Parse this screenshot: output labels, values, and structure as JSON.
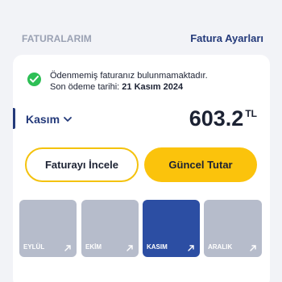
{
  "header": {
    "title": "FATURALARIM",
    "settings_link": "Fatura Ayarları"
  },
  "notice": {
    "message": "Ödenmemiş faturanız bulunmamaktadır.",
    "due_prefix": "Son ödeme tarihi:",
    "due_date": "21 Kasım 2024",
    "icon": "check-circle-icon",
    "color": "#2dbf55"
  },
  "bill": {
    "selected_month": "Kasım",
    "amount": "603.2",
    "currency": "TL"
  },
  "actions": {
    "review_label": "Faturayı İncele",
    "current_label": "Güncel Tutar"
  },
  "months": [
    {
      "label": "EYLÜL",
      "active": false
    },
    {
      "label": "EKİM",
      "active": false
    },
    {
      "label": "KASIM",
      "active": true
    },
    {
      "label": "ARALIK",
      "active": false
    }
  ],
  "colors": {
    "accent": "#fbc30c",
    "brand": "#243a7a",
    "active_month": "#2c4ea3",
    "inactive_month": "#b6bccb"
  }
}
